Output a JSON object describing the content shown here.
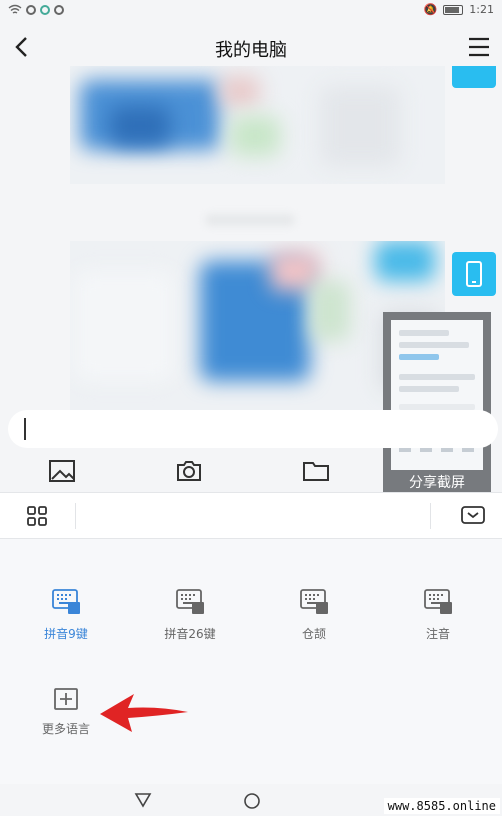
{
  "status_bar": {
    "time": "1:21"
  },
  "header": {
    "title": "我的电脑"
  },
  "share_panel": {
    "label": "分享截屏"
  },
  "input": {
    "placeholder": ""
  },
  "keyboard": {
    "languages": [
      {
        "label": "拼音9键",
        "badge": "拼",
        "active": true
      },
      {
        "label": "拼音26键",
        "badge": "拼",
        "active": false
      },
      {
        "label": "仓颉",
        "badge": "仓",
        "active": false
      },
      {
        "label": "注音",
        "badge": "注",
        "active": false
      }
    ],
    "more_languages_label": "更多语言"
  },
  "watermark": "www.8585.online",
  "colors": {
    "accent": "#3a85d8",
    "side_button": "#29bdf0",
    "arrow": "#e02424"
  },
  "icons": [
    "back-icon",
    "menu-icon",
    "image-icon",
    "camera-icon",
    "folder-icon",
    "grid-icon",
    "collapse-keyboard-icon",
    "keyboard-icon",
    "plus-box-icon",
    "triangle-back-icon",
    "circle-home-icon"
  ]
}
